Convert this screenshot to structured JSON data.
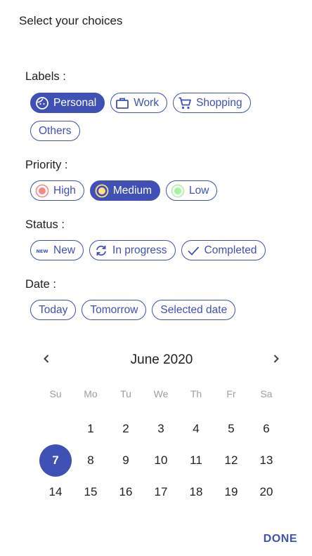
{
  "title": "Select your choices",
  "labels": {
    "heading": "Labels :",
    "chips": [
      {
        "label": "Personal",
        "icon": "face-icon",
        "selected": true
      },
      {
        "label": "Work",
        "icon": "briefcase-icon",
        "selected": false
      },
      {
        "label": "Shopping",
        "icon": "cart-icon",
        "selected": false
      },
      {
        "label": "Others",
        "icon": "",
        "selected": false
      }
    ]
  },
  "priority": {
    "heading": "Priority :",
    "chips": [
      {
        "label": "High",
        "icon": "high-dot-icon",
        "color": "#f48787",
        "selected": false
      },
      {
        "label": "Medium",
        "icon": "medium-dot-icon",
        "color": "#ffe082",
        "selected": true
      },
      {
        "label": "Low",
        "icon": "low-dot-icon",
        "color": "#a5f3a0",
        "selected": false
      }
    ]
  },
  "status": {
    "heading": "Status :",
    "chips": [
      {
        "label": "New",
        "icon": "new-badge-icon",
        "selected": false
      },
      {
        "label": "In progress",
        "icon": "sync-icon",
        "selected": false
      },
      {
        "label": "Completed",
        "icon": "check-icon",
        "selected": false
      }
    ]
  },
  "date": {
    "heading": "Date :",
    "chips": [
      {
        "label": "Today",
        "selected": false
      },
      {
        "label": "Tomorrow",
        "selected": false
      },
      {
        "label": "Selected date",
        "selected": false
      }
    ]
  },
  "calendar": {
    "month_label": "June 2020",
    "weekdays": [
      "Su",
      "Mo",
      "Tu",
      "We",
      "Th",
      "Fr",
      "Sa"
    ],
    "leading_blanks": 1,
    "days": [
      "1",
      "2",
      "3",
      "4",
      "5",
      "6",
      "7",
      "8",
      "9",
      "10",
      "11",
      "12",
      "13",
      "14",
      "15",
      "16",
      "17",
      "18",
      "19",
      "20"
    ],
    "selected_day": "7"
  },
  "done_label": "DONE",
  "colors": {
    "accent": "#3f51b5"
  }
}
